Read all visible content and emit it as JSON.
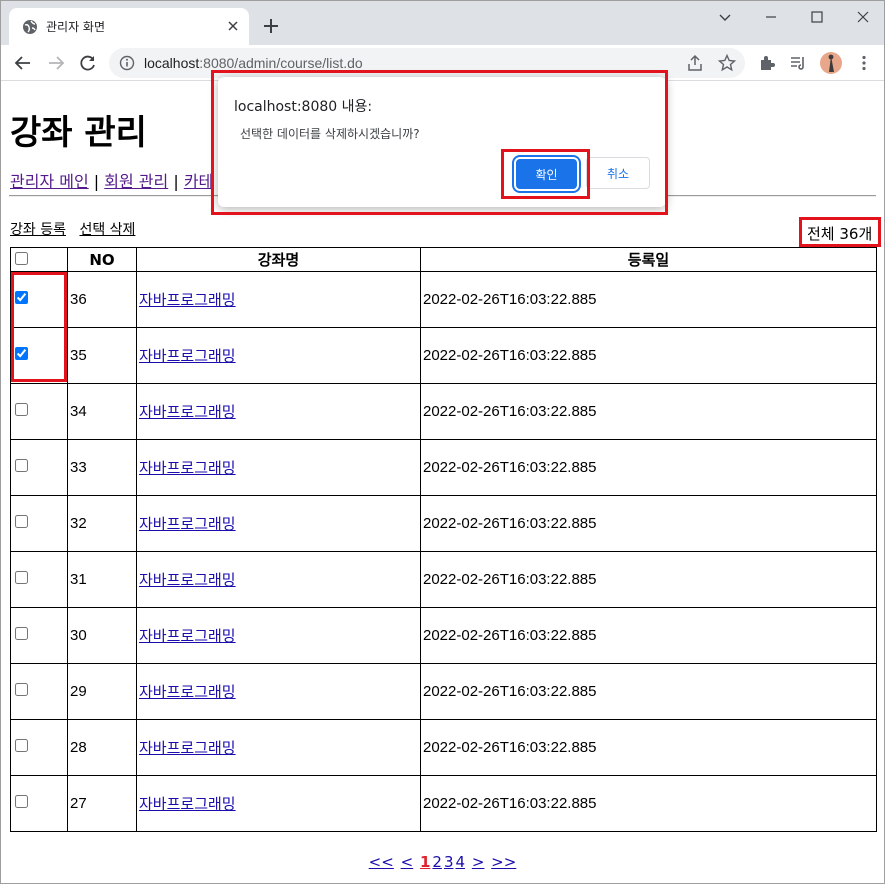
{
  "browser": {
    "tab_title": "관리자 화면",
    "url_host": "localhost",
    "url_port_path": ":8080/admin/course/list.do"
  },
  "page": {
    "title": "강좌 관리",
    "nav": [
      {
        "label": "관리자 메인"
      },
      {
        "label": "회원 관리"
      },
      {
        "label": "카테"
      }
    ],
    "nav_separator": "|",
    "actions": {
      "add": "강좌 등록",
      "delete_selected": "선택 삭제"
    },
    "total": "전체 36개",
    "table": {
      "headers": {
        "no": "NO",
        "name": "강좌명",
        "date": "등록일"
      },
      "rows": [
        {
          "no": "36",
          "name": "자바프로그래밍",
          "date": "2022-02-26T16:03:22.885",
          "checked": true
        },
        {
          "no": "35",
          "name": "자바프로그래밍",
          "date": "2022-02-26T16:03:22.885",
          "checked": true
        },
        {
          "no": "34",
          "name": "자바프로그래밍",
          "date": "2022-02-26T16:03:22.885",
          "checked": false
        },
        {
          "no": "33",
          "name": "자바프로그래밍",
          "date": "2022-02-26T16:03:22.885",
          "checked": false
        },
        {
          "no": "32",
          "name": "자바프로그래밍",
          "date": "2022-02-26T16:03:22.885",
          "checked": false
        },
        {
          "no": "31",
          "name": "자바프로그래밍",
          "date": "2022-02-26T16:03:22.885",
          "checked": false
        },
        {
          "no": "30",
          "name": "자바프로그래밍",
          "date": "2022-02-26T16:03:22.885",
          "checked": false
        },
        {
          "no": "29",
          "name": "자바프로그래밍",
          "date": "2022-02-26T16:03:22.885",
          "checked": false
        },
        {
          "no": "28",
          "name": "자바프로그래밍",
          "date": "2022-02-26T16:03:22.885",
          "checked": false
        },
        {
          "no": "27",
          "name": "자바프로그래밍",
          "date": "2022-02-26T16:03:22.885",
          "checked": false
        }
      ]
    },
    "pager": {
      "first": "<<",
      "prev": "<",
      "pages": [
        "1",
        "2",
        "3",
        "4"
      ],
      "current": "1",
      "next": ">",
      "last": ">>"
    }
  },
  "dialog": {
    "title": "localhost:8080 내용:",
    "message": "선택한 데이터를 삭제하시겠습니까?",
    "ok": "확인",
    "cancel": "취소"
  },
  "colors": {
    "highlight": "#e3131d",
    "accent": "#1a73e8",
    "link_visited": "#551a8b",
    "pager_current": "#e0242f"
  }
}
